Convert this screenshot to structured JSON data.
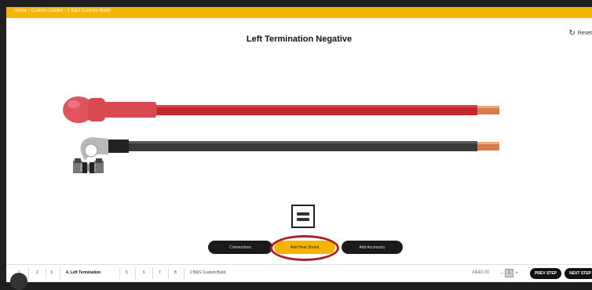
{
  "header": {
    "breadcrumb": "Home › Custom Cables › 2 B&S Custom Build"
  },
  "main": {
    "title": "Left Termination Negative",
    "reset_label": "Reset",
    "tool_icon": "cable-configuration-icon"
  },
  "actions": [
    {
      "label": "Connections"
    },
    {
      "label": "Add Heat Shrink"
    },
    {
      "label": "Add Accessory"
    }
  ],
  "steps": [
    {
      "label": "1"
    },
    {
      "label": "2"
    },
    {
      "label": "3"
    },
    {
      "label": "4. Left Termination"
    },
    {
      "label": "5"
    },
    {
      "label": "6"
    },
    {
      "label": "7"
    },
    {
      "label": "8"
    },
    {
      "label": "2 B&S Custom Build"
    }
  ],
  "footer": {
    "price": "A$40.00",
    "quantity": "1",
    "prev_label": "PREV STEP",
    "next_label": "NEXT STEP"
  },
  "colors": {
    "accent": "#f5b400",
    "cable_red": "#c8262f",
    "cable_black": "#3a3a3a",
    "highlight_ring": "#a4232a",
    "copper": "#d87a4a"
  }
}
